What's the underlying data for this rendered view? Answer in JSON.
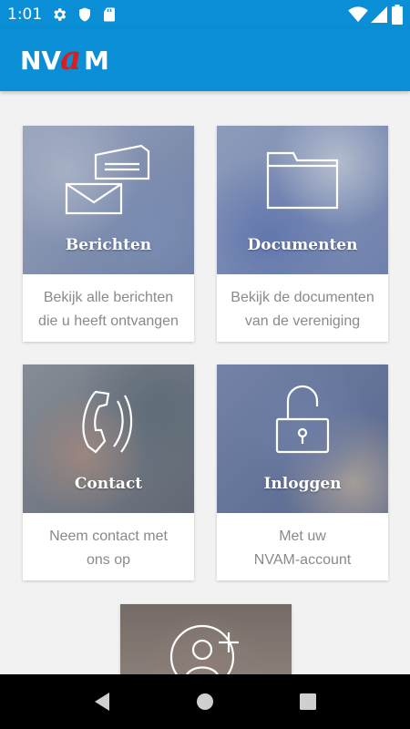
{
  "status": {
    "time": "1:01"
  },
  "app": {
    "logo_text": "NVAM"
  },
  "colors": {
    "primary": "#0a8fd6",
    "logo_accent": "#d62020"
  },
  "cards": [
    {
      "title": "Berichten",
      "desc_line1": "Bekijk alle berichten",
      "desc_line2": "die u heeft ontvangen",
      "icon": "envelope-icon"
    },
    {
      "title": "Documenten",
      "desc_line1": "Bekijk de documenten",
      "desc_line2": "van de vereniging",
      "icon": "folder-icon"
    },
    {
      "title": "Contact",
      "desc_line1": "Neem contact met",
      "desc_line2": "ons op",
      "icon": "phone-icon"
    },
    {
      "title": "Inloggen",
      "desc_line1": "Met uw",
      "desc_line2": "NVAM-account",
      "icon": "lock-icon"
    },
    {
      "title": "",
      "icon": "add-user-icon"
    }
  ]
}
